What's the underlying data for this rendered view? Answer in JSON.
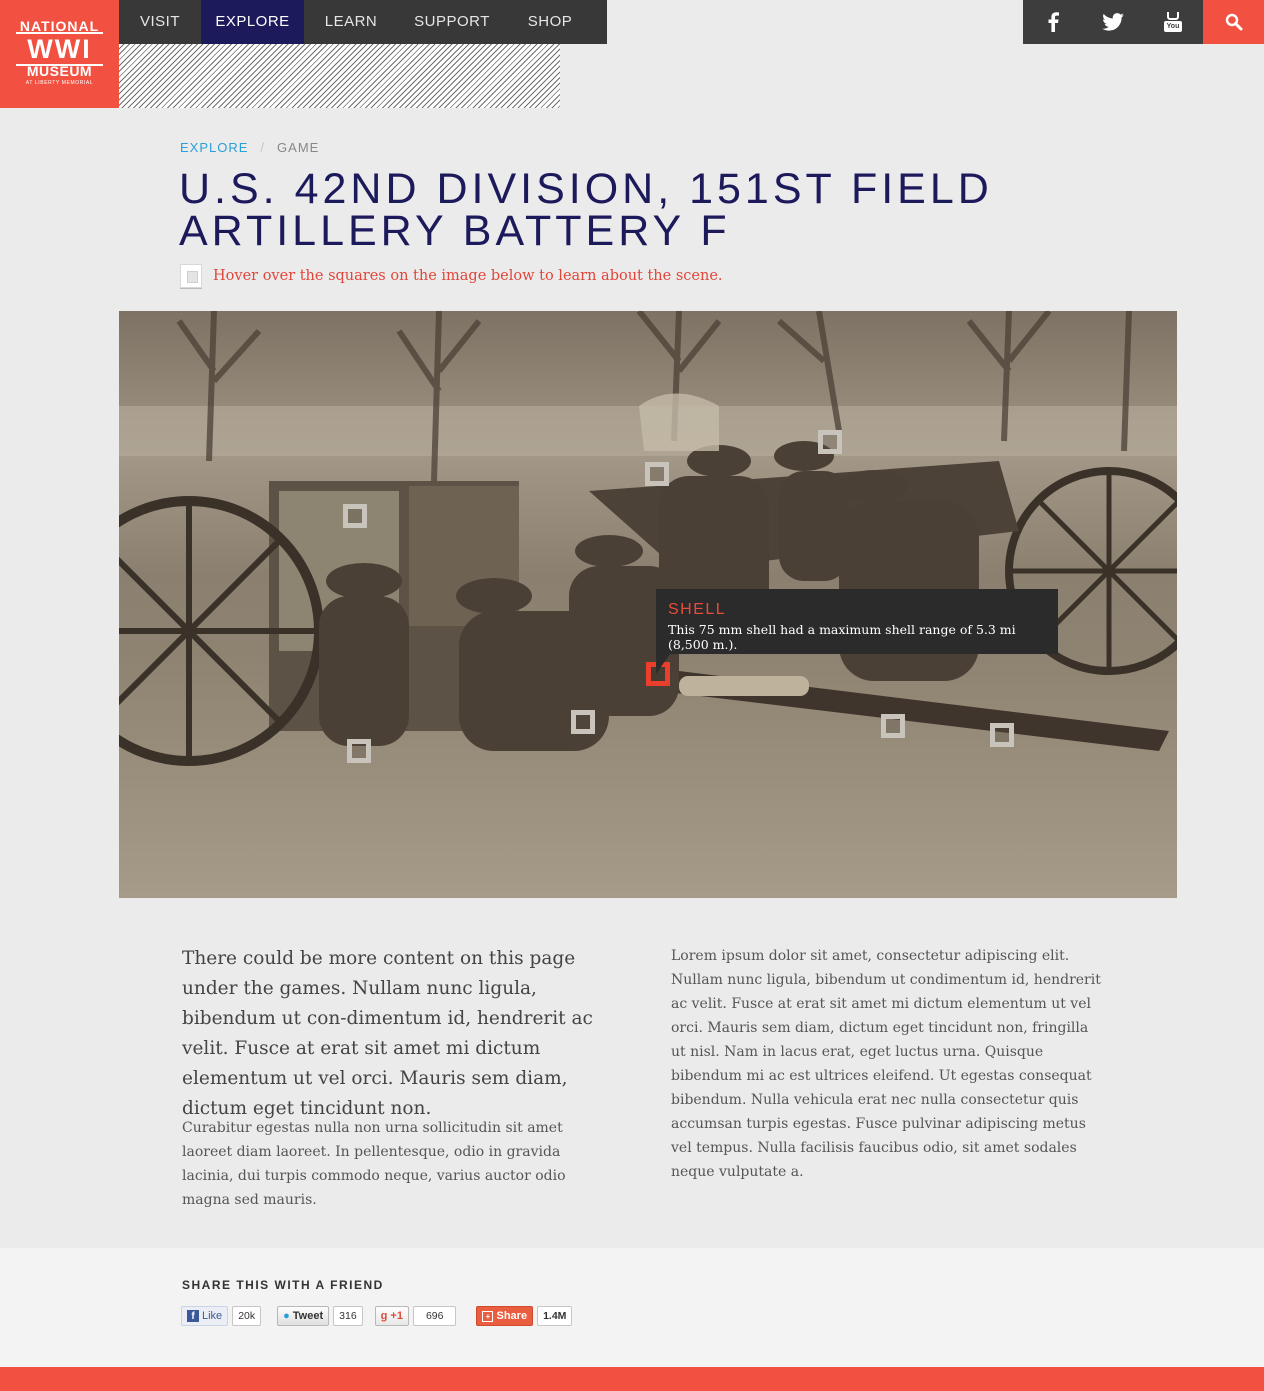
{
  "logo": {
    "line1": "NATIONAL",
    "line2": "WWI",
    "line3": "MUSEUM",
    "line4": "AT LIBERTY MEMORIAL"
  },
  "nav": {
    "items": [
      {
        "label": "VISIT"
      },
      {
        "label": "EXPLORE",
        "active": true
      },
      {
        "label": "LEARN"
      },
      {
        "label": "SUPPORT"
      },
      {
        "label": "SHOP"
      }
    ]
  },
  "social": {
    "icons": [
      "facebook-icon",
      "twitter-icon",
      "youtube-icon"
    ],
    "youtube_text": "You Tube",
    "search_icon": "search-icon"
  },
  "breadcrumb": {
    "parent": "EXPLORE",
    "separator": "/",
    "current": "GAME"
  },
  "page": {
    "title": "U.S. 42ND DIVISION, 151ST FIELD ARTILLERY BATTERY F",
    "hint": "Hover over the squares on the image below to learn about the scene."
  },
  "tooltip": {
    "title": "SHELL",
    "body": "This 75 mm shell had a maximum shell range of 5.3 mi (8,500 m.)."
  },
  "content": {
    "lead": "There could be more content on this page under the games. Nullam nunc ligula, bibendum ut con-dimentum id, hendrerit ac velit. Fusce at erat sit amet mi dictum elementum ut vel orci. Mauris sem diam, dictum eget tincidunt non.",
    "small_left": "Curabitur egestas nulla non urna sollicitudin sit amet laoreet diam laoreet. In pellentesque, odio in gravida lacinia, dui turpis commodo neque, varius auctor odio magna sed mauris.",
    "small_right": "Lorem ipsum dolor sit amet, consectetur adipiscing elit. Nullam nunc ligula, bibendum ut condimentum id, hendrerit ac velit. Fusce at erat sit amet mi dictum elementum ut vel orci. Mauris sem diam, dictum eget tincidunt non, fringilla ut nisl. Nam in lacus erat, eget luctus urna. Quisque bibendum mi ac est ultrices eleifend. Ut egestas consequat bibendum. Nulla vehicula erat nec nulla consectetur quis accumsan turpis egestas. Fusce pulvinar adipiscing metus vel tempus. Nulla facilisis faucibus odio, sit amet sodales neque vulputate a."
  },
  "share": {
    "title": "SHARE THIS WITH A FRIEND",
    "facebook": {
      "label": "Like",
      "count": "20k"
    },
    "twitter": {
      "label": "Tweet",
      "count": "316"
    },
    "google": {
      "label": "+1",
      "count": "696"
    },
    "sharethis": {
      "label": "Share",
      "count": "1.4M"
    }
  },
  "colors": {
    "brand_red": "#f25141",
    "nav_active": "#1d1a5c",
    "link_blue": "#2aa0d9",
    "hint_red": "#e1463a"
  }
}
